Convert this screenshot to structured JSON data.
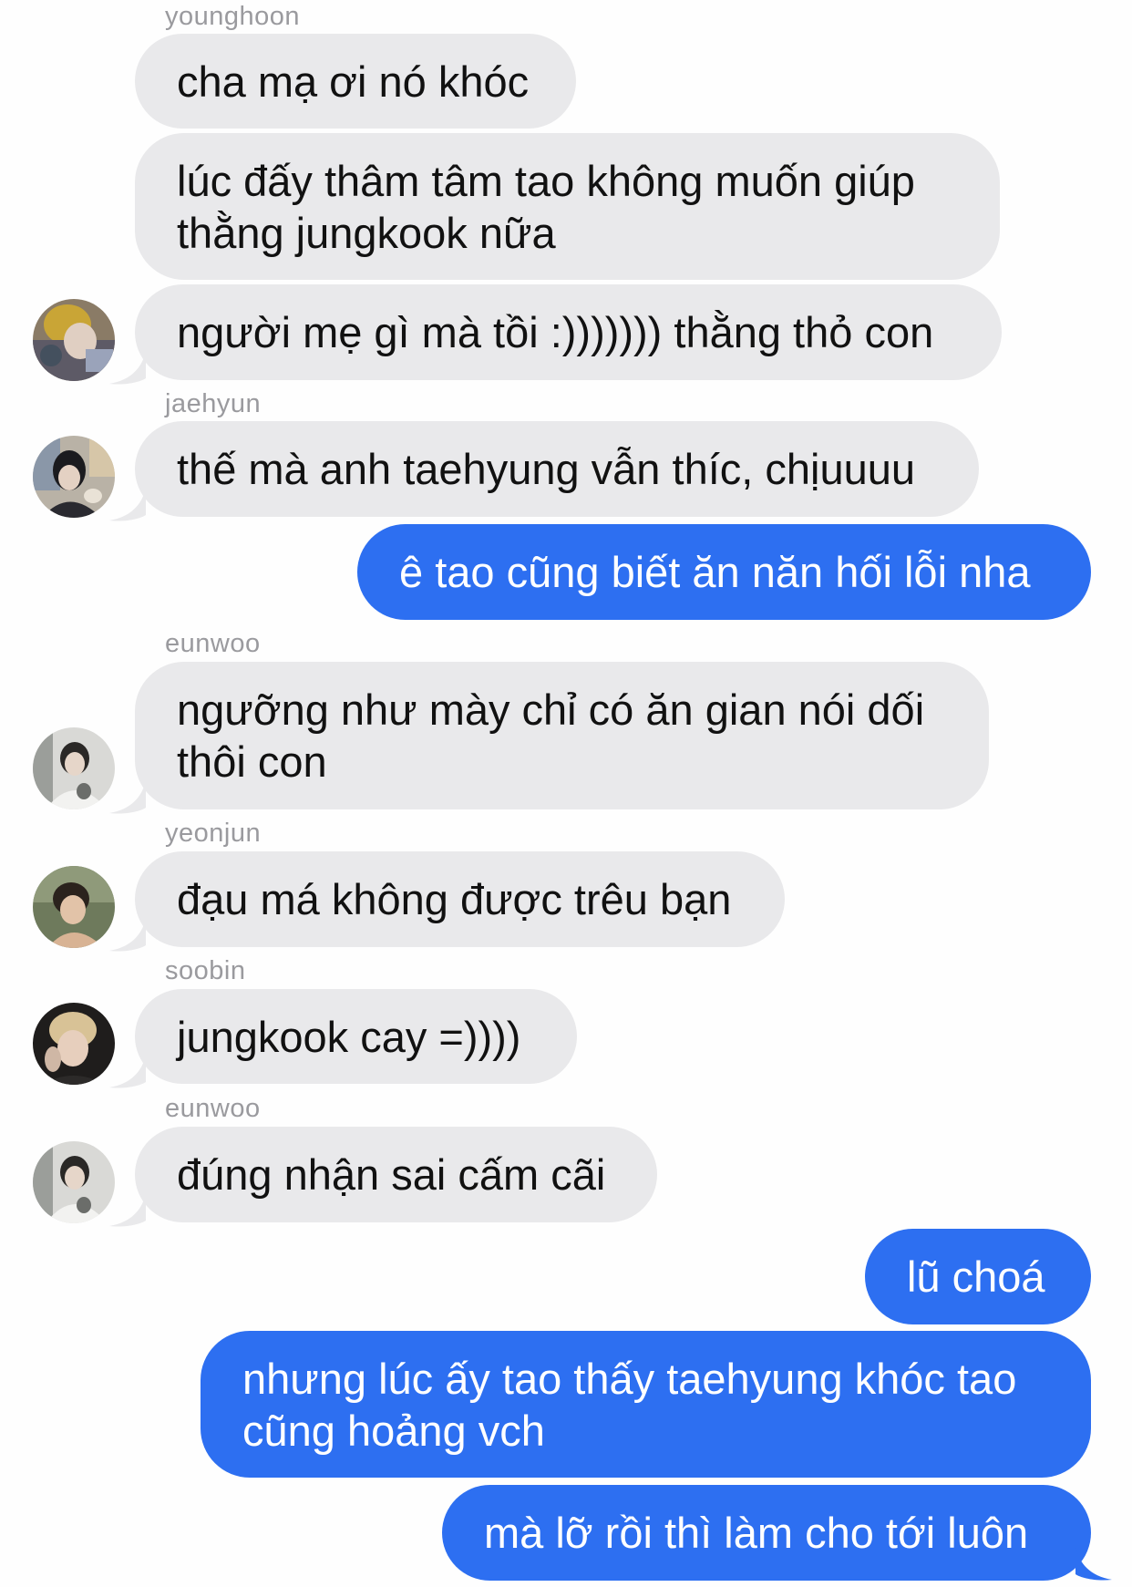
{
  "colors": {
    "background": "#fefefe",
    "incoming_bubble": "#e9e9eb",
    "outgoing_bubble": "#2d6ff1",
    "sender_label": "#9a9a9e"
  },
  "messages": [
    {
      "sender": "younghoon",
      "text": "cha mạ ơi nó khóc"
    },
    {
      "text": "lúc đấy thâm tâm tao không muốn giúp\nthằng jungkook nữa"
    },
    {
      "text": "người mẹ gì mà tồi :))))))) thằng thỏ con",
      "avatar": "avatar-younghoon"
    },
    {
      "sender": "jaehyun",
      "text": "thế mà anh taehyung vẫn thíc, chịuuuu",
      "avatar": "avatar-jaehyun"
    },
    {
      "text": "ê tao cũng biết ăn năn hối lỗi nha",
      "outgoing": true
    },
    {
      "sender": "eunwoo",
      "text": "ngưỡng như mày chỉ có ăn gian nói dối\nthôi con",
      "avatar": "avatar-eunwoo"
    },
    {
      "sender": "yeonjun",
      "text": "đạu má không được trêu bạn",
      "avatar": "avatar-yeonjun"
    },
    {
      "sender": "soobin",
      "text": "jungkook cay =))))",
      "avatar": "avatar-soobin"
    },
    {
      "sender": "eunwoo",
      "text": "đúng nhận sai cấm cãi",
      "avatar": "avatar-eunwoo"
    },
    {
      "text": "lũ choá",
      "outgoing": true
    },
    {
      "text": "nhưng lúc ấy tao thấy taehyung khóc tao\ncũng hoảng vch",
      "outgoing": true
    },
    {
      "text": "mà lỡ rồi thì làm cho tới luôn",
      "outgoing": true
    }
  ]
}
